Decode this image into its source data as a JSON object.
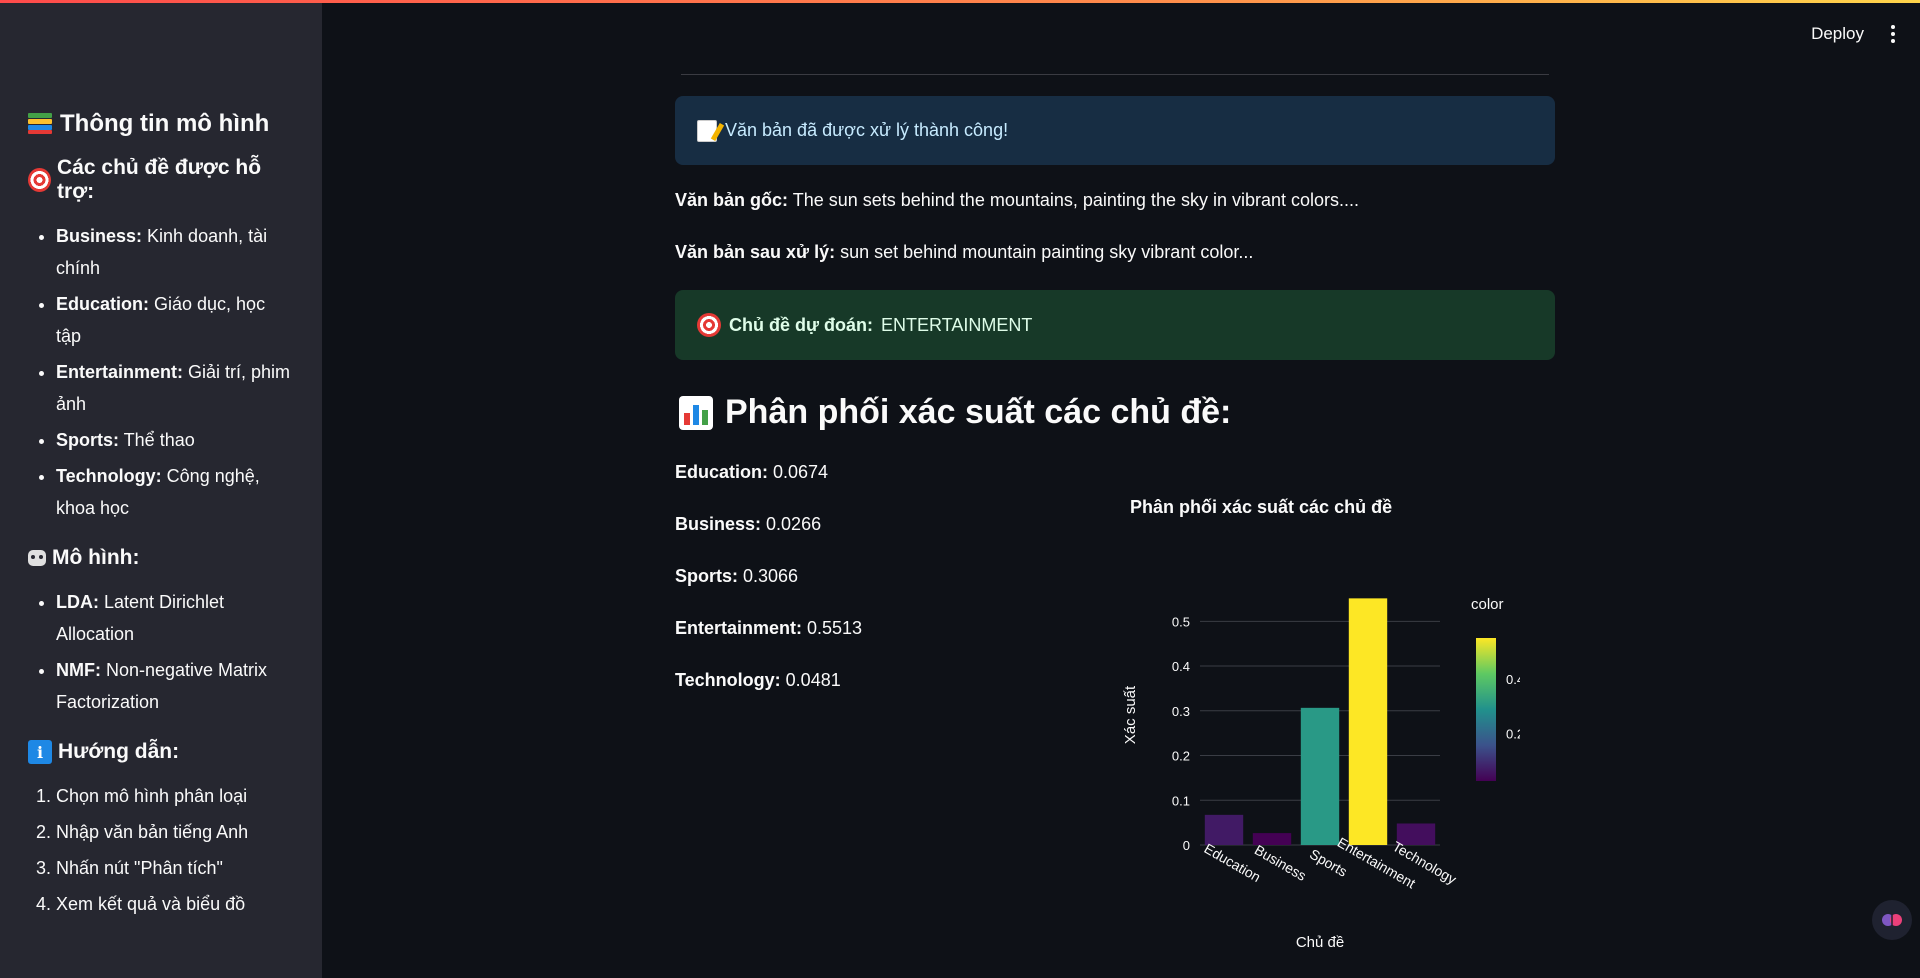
{
  "header": {
    "deploy_label": "Deploy"
  },
  "sidebar": {
    "title": "Thông tin mô hình",
    "topics_heading": "Các chủ đề được hỗ trợ:",
    "topics": [
      {
        "name": "Business:",
        "desc": "Kinh doanh, tài chính"
      },
      {
        "name": "Education:",
        "desc": "Giáo dục, học tập"
      },
      {
        "name": "Entertainment:",
        "desc": "Giải trí, phim ảnh"
      },
      {
        "name": "Sports:",
        "desc": "Thể thao"
      },
      {
        "name": "Technology:",
        "desc": "Công nghệ, khoa học"
      }
    ],
    "models_heading": "Mô hình:",
    "models": [
      {
        "name": "LDA:",
        "desc": "Latent Dirichlet Allocation"
      },
      {
        "name": "NMF:",
        "desc": "Non-negative Matrix Factorization"
      }
    ],
    "guide_heading": "Hướng dẫn:",
    "guide": [
      "Chọn mô hình phân loại",
      "Nhập văn bản tiếng Anh",
      "Nhấn nút \"Phân tích\"",
      "Xem kết quả và biểu đồ"
    ]
  },
  "main": {
    "success_message": "Văn bản đã được xử lý thành công!",
    "original_label": "Văn bản gốc:",
    "original_text": "The sun sets behind the mountains, painting the sky in vibrant colors....",
    "processed_label": "Văn bản sau xử lý:",
    "processed_text": "sun set behind mountain painting sky vibrant color...",
    "prediction_label": "Chủ đề dự đoán:",
    "prediction_value": "ENTERTAINMENT",
    "distribution_title": "Phân phối xác suất các chủ đề:",
    "probabilities": [
      {
        "label": "Education:",
        "value": "0.0674"
      },
      {
        "label": "Business:",
        "value": "0.0266"
      },
      {
        "label": "Sports:",
        "value": "0.3066"
      },
      {
        "label": "Entertainment:",
        "value": "0.5513"
      },
      {
        "label": "Technology:",
        "value": "0.0481"
      }
    ]
  },
  "chart_data": {
    "type": "bar",
    "title": "Phân phối xác suất các chủ đề",
    "xlabel": "Chủ đề",
    "ylabel": "Xác suất",
    "categories": [
      "Education",
      "Business",
      "Sports",
      "Entertainment",
      "Technology"
    ],
    "values": [
      0.0674,
      0.0266,
      0.3066,
      0.5513,
      0.0481
    ],
    "ylim": [
      0,
      0.57
    ],
    "yticks": [
      "0",
      "0.1",
      "0.2",
      "0.3",
      "0.4",
      "0.5"
    ],
    "colorscale": "viridis",
    "colorbar": {
      "title": "color",
      "ticks": [
        "0.2",
        "0.4"
      ]
    },
    "grid": true
  }
}
